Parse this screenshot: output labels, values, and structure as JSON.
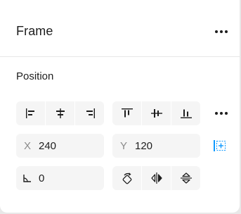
{
  "panel": {
    "title": "Frame"
  },
  "position": {
    "label": "Position",
    "x": {
      "prefix": "X",
      "value": "240"
    },
    "y": {
      "prefix": "Y",
      "value": "120"
    },
    "rotation": {
      "value": "0"
    }
  },
  "colors": {
    "icon": "#1e1e1e",
    "muted": "#8a8a8a",
    "accent": "#0d99ff",
    "field_bg": "#f5f5f5"
  },
  "icons": {
    "horizontal_align": [
      "align-left-icon",
      "align-horizontal-center-icon",
      "align-right-icon"
    ],
    "vertical_align": [
      "align-top-icon",
      "align-vertical-center-icon",
      "align-bottom-icon"
    ],
    "transform": [
      "rotate-icon",
      "flip-horizontal-icon",
      "flip-vertical-icon"
    ],
    "constraints": "constraints-icon"
  }
}
